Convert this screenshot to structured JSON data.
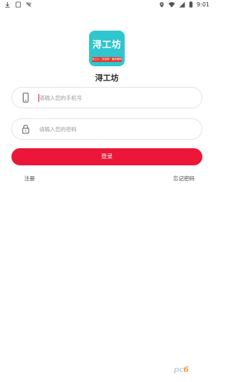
{
  "status_bar": {
    "time": "9:01",
    "left_icons": [
      "download-icon",
      "card-icon",
      "wifi-off-icon"
    ],
    "right_icons": [
      "location-icon",
      "wifi-icon",
      "signal-icon",
      "battery-icon"
    ]
  },
  "app": {
    "logo_text": "浔工坊",
    "logo_band_text": "找工人 · 找保姆 · 最新兼职",
    "name": "浔工坊",
    "colors": {
      "logo_bg": "#2fc6cf",
      "accent": "#ec1738"
    }
  },
  "form": {
    "phone_placeholder": "请输入您的手机号",
    "phone_value": "",
    "password_placeholder": "请输入您的密码",
    "password_value": "",
    "login_label": "登录",
    "register_label": "注册",
    "forgot_label": "忘记密码"
  },
  "watermark": {
    "text_main": "pc",
    "text_accent": "6"
  }
}
